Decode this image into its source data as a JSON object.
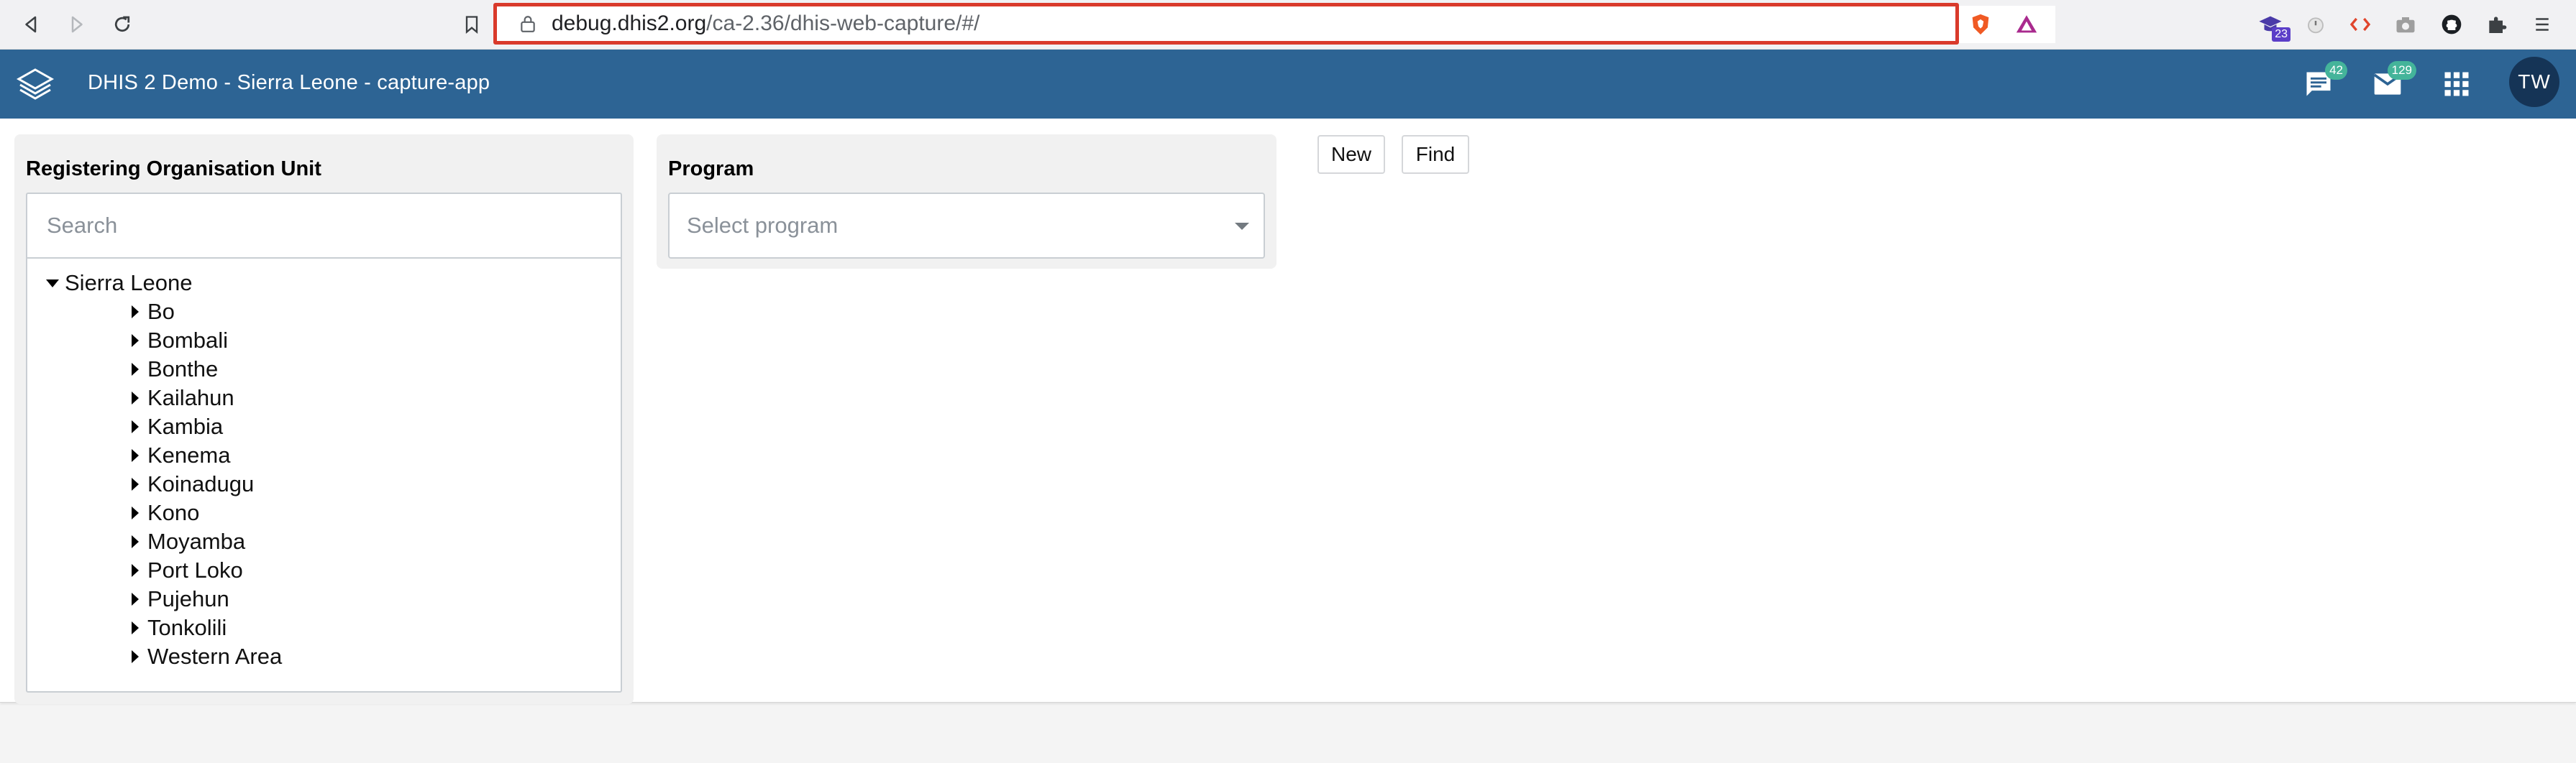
{
  "browser": {
    "url_host": "debug.dhis2.org",
    "url_path": "/ca-2.36/dhis-web-capture/#/",
    "extension_badge": "23",
    "icons": [
      "back-icon",
      "forward-icon",
      "reload-icon",
      "bookmark-icon",
      "lock-icon",
      "brave-shield-icon",
      "brave-rewards-icon",
      "graduation-cap-icon",
      "timer-icon",
      "code-icon",
      "camera-icon",
      "github-icon",
      "puzzle-icon",
      "menu-icon"
    ]
  },
  "header": {
    "title": "DHIS 2 Demo - Sierra Leone - capture-app",
    "messages_count": "42",
    "interpretations_count": "129",
    "profile_initials": "TW",
    "color": "#2d6494"
  },
  "org_unit": {
    "title": "Registering Organisation Unit",
    "search_placeholder": "Search",
    "root": "Sierra Leone",
    "children": [
      "Bo",
      "Bombali",
      "Bonthe",
      "Kailahun",
      "Kambia",
      "Kenema",
      "Koinadugu",
      "Kono",
      "Moyamba",
      "Port Loko",
      "Pujehun",
      "Tonkolili",
      "Western Area"
    ]
  },
  "program": {
    "title": "Program",
    "placeholder": "Select program"
  },
  "actions": {
    "new_label": "New",
    "find_label": "Find"
  }
}
